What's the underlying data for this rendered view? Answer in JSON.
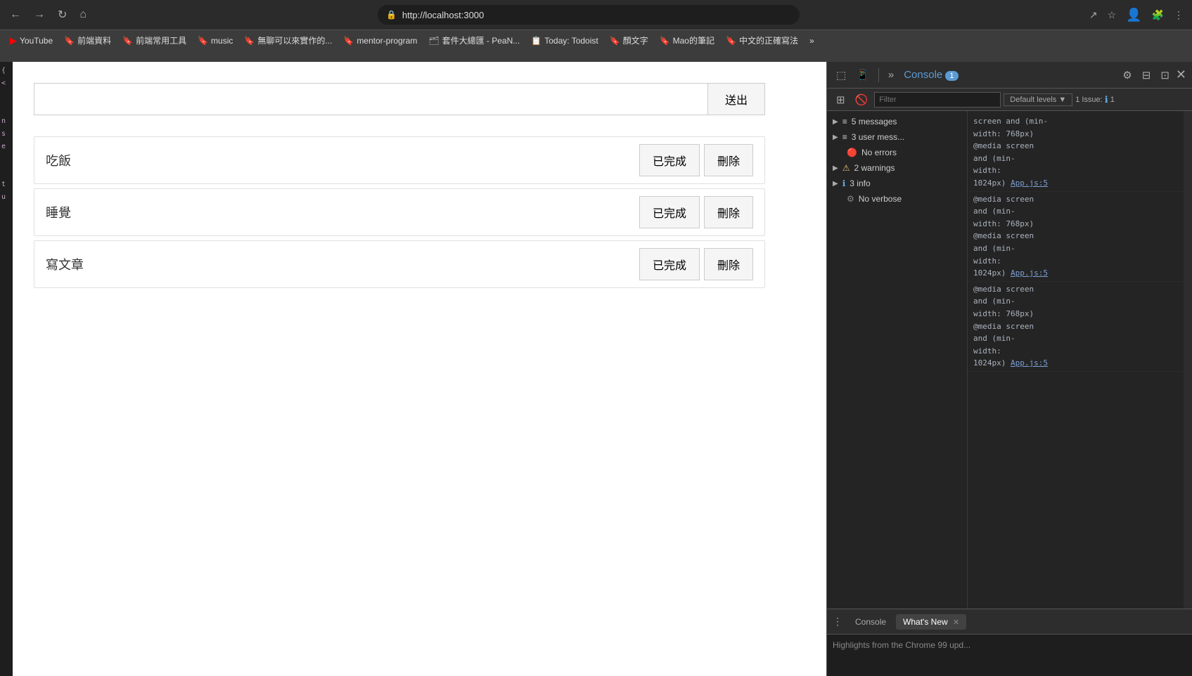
{
  "browser": {
    "url": "http://localhost:3000",
    "back_label": "←",
    "forward_label": "→",
    "reload_label": "↻",
    "home_label": "⌂"
  },
  "bookmarks": [
    {
      "id": "yt",
      "label": "YouTube",
      "icon": "▶",
      "icon_color": "#ff0000"
    },
    {
      "id": "b1",
      "label": "前端資料",
      "icon": "🔖",
      "icon_color": "#f90"
    },
    {
      "id": "b2",
      "label": "前端常用工具",
      "icon": "🔖",
      "icon_color": "#f90"
    },
    {
      "id": "b3",
      "label": "music",
      "icon": "🔖",
      "icon_color": "#ff0"
    },
    {
      "id": "b4",
      "label": "無聊可以來實作的...",
      "icon": "🔖",
      "icon_color": "#ff0"
    },
    {
      "id": "b5",
      "label": "mentor-program",
      "icon": "🔖",
      "icon_color": "#f90"
    },
    {
      "id": "b6",
      "label": "套件大總匯 - PeaN...",
      "icon": "🗂",
      "icon_color": "#aaa"
    },
    {
      "id": "b7",
      "label": "Today: Todoist",
      "icon": "📋",
      "icon_color": "#db4035"
    },
    {
      "id": "b8",
      "label": "顏文字",
      "icon": "🔖",
      "icon_color": "#f90"
    },
    {
      "id": "b9",
      "label": "Mao的筆記",
      "icon": "🔖",
      "icon_color": "#f90"
    },
    {
      "id": "b10",
      "label": "中文的正確寫法",
      "icon": "🔖",
      "icon_color": "#f90"
    }
  ],
  "app": {
    "input_placeholder": "",
    "submit_label": "送出",
    "todos": [
      {
        "id": 1,
        "text": "吃飯",
        "complete_label": "已完成",
        "delete_label": "刪除"
      },
      {
        "id": 2,
        "text": "睡覺",
        "complete_label": "已完成",
        "delete_label": "刪除"
      },
      {
        "id": 3,
        "text": "寫文章",
        "complete_label": "已完成",
        "delete_label": "刪除"
      }
    ]
  },
  "devtools": {
    "toolbar": {
      "inspect_icon": "⬚",
      "device_icon": "📱",
      "more_icon": "»",
      "console_tab": "1",
      "settings_icon": "⚙",
      "dock_icon": "⊟",
      "close_icon": "✕",
      "undock_icon": "⊡",
      "show_icon": "👁"
    },
    "filter_placeholder": "Filter",
    "levels_label": "Default levels",
    "issue_label": "1 Issue:",
    "console_tree": [
      {
        "id": "messages",
        "label": "5 messages",
        "icon": "≡",
        "arrow": "▶",
        "color": "default"
      },
      {
        "id": "user_messages",
        "label": "3 user mess...",
        "icon": "≡",
        "arrow": "▶",
        "color": "default"
      },
      {
        "id": "no_errors",
        "label": "No errors",
        "icon": "🔴",
        "color": "error"
      },
      {
        "id": "warnings",
        "label": "2 warnings",
        "icon": "⚠",
        "arrow": "▶",
        "color": "warning"
      },
      {
        "id": "info",
        "label": "3 info",
        "icon": "ℹ",
        "arrow": "▶",
        "color": "info"
      },
      {
        "id": "no_verbose",
        "label": "No verbose",
        "icon": "⚙",
        "color": "verbose"
      }
    ],
    "console_content": [
      {
        "text": "screen and (min-width: 768px) @media screen and (min-width: 1024px)",
        "link": "App.js:5"
      },
      {
        "text": "@media screen and (min-width: 768px) @media screen and (min-width: 1024px)",
        "link": "App.js:5"
      },
      {
        "text": "@media screen and (min-width: 768px) @media screen and (min-width: 1024px)",
        "link": "App.js:5"
      }
    ],
    "bottom_tabs": [
      {
        "id": "console",
        "label": "Console",
        "active": false
      },
      {
        "id": "whats_new",
        "label": "What's New",
        "active": true,
        "closeable": true
      }
    ],
    "bottom_content": "Highlights from the Chrome 99 upd..."
  }
}
